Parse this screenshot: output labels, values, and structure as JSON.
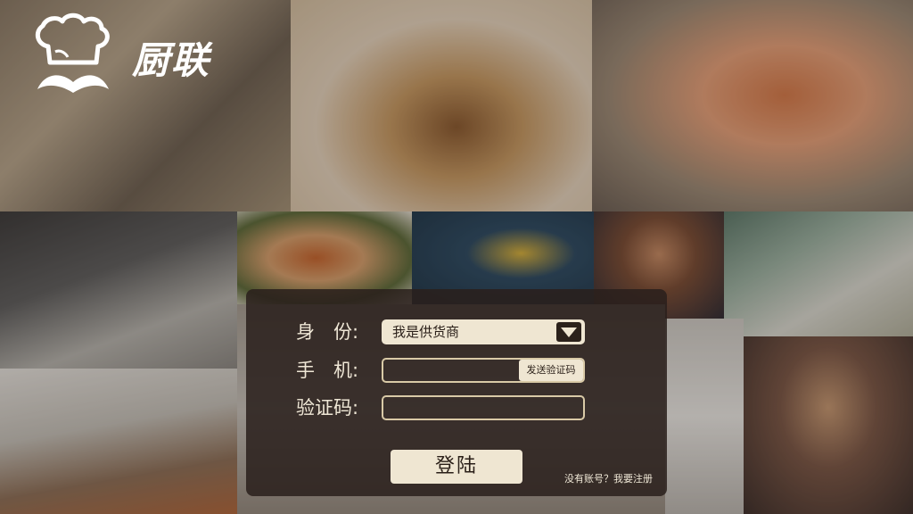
{
  "brand": {
    "name": "厨联",
    "logo_icon": "chef-mustache-icon"
  },
  "login_form": {
    "identity_label": "身　份:",
    "identity_value": "我是供货商",
    "phone_label": "手　机:",
    "phone_value": "",
    "send_code_label": "发送验证码",
    "code_label": "验证码:",
    "code_value": "",
    "submit_label": "登陆",
    "register_link": "没有账号？我要注册"
  },
  "colors": {
    "panel": "#2a201c",
    "accent": "#efe6d2",
    "border": "#d9caa7"
  }
}
